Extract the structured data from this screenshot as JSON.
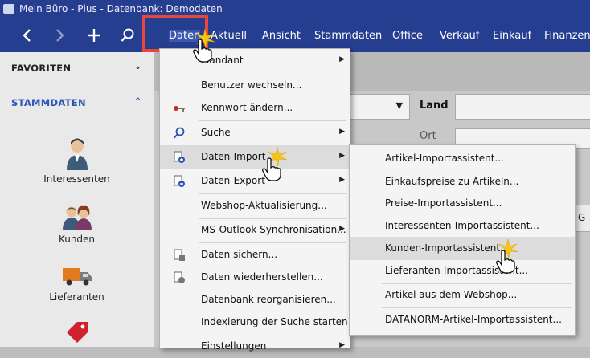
{
  "window": {
    "title": "Mein Büro - Plus - Datenbank: Demodaten"
  },
  "nav": {
    "icons": [
      "back-icon",
      "forward-icon",
      "plus-icon",
      "search-icon"
    ],
    "menu": [
      "Daten",
      "Aktuell",
      "Ansicht",
      "Stammdaten",
      "Office",
      "Verkauf",
      "Einkauf",
      "Finanzen"
    ]
  },
  "sidebar": {
    "favorites_label": "FAVORITEN",
    "stammdaten_label": "STAMMDATEN",
    "items": [
      "Interessenten",
      "Kunden",
      "Lieferanten"
    ]
  },
  "form": {
    "land_label": "Land",
    "ort_label": "Ort",
    "partial_label": "G"
  },
  "daten_menu": {
    "items": [
      {
        "label": "Mandant",
        "arrow": true
      },
      {
        "label": "Benutzer wechseln...",
        "arrow": false
      },
      {
        "label": "Kennwort ändern...",
        "arrow": false
      },
      {
        "label": "Suche",
        "arrow": true
      },
      {
        "label": "Daten-Import",
        "arrow": true
      },
      {
        "label": "Daten-Export",
        "arrow": true
      },
      {
        "label": "Webshop-Aktualisierung...",
        "arrow": false
      },
      {
        "label": "MS-Outlook Synchronisation...",
        "arrow": true
      },
      {
        "label": "Daten sichern...",
        "arrow": false
      },
      {
        "label": "Daten wiederherstellen...",
        "arrow": false
      },
      {
        "label": "Datenbank reorganisieren...",
        "arrow": false
      },
      {
        "label": "Indexierung der Suche starten",
        "arrow": false
      },
      {
        "label": "Einstellungen",
        "arrow": true
      }
    ]
  },
  "import_submenu": {
    "items": [
      "Artikel-Importassistent...",
      "Einkaufspreise zu Artikeln...",
      "Preise-Importassistent...",
      "Interessenten-Importassistent...",
      "Kunden-Importassistent...",
      "Lieferanten-Importassistent...",
      "Artikel aus dem Webshop...",
      "DATANORM-Artikel-Importassistent..."
    ]
  },
  "colors": {
    "accent": "#263e8f",
    "highlight_box": "#e8453c"
  }
}
